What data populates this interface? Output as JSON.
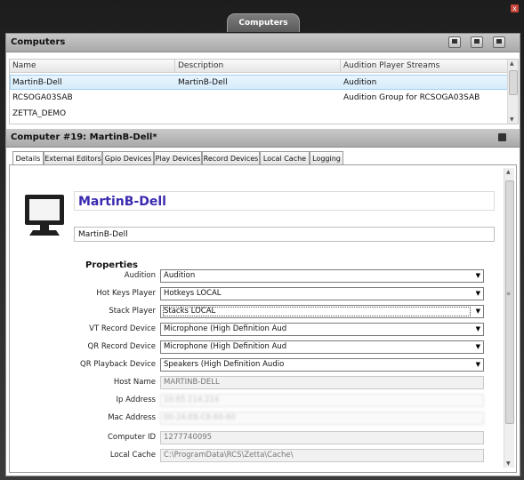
{
  "window": {
    "title": "Computers",
    "close_glyph": "x"
  },
  "computers_section": {
    "title": "Computers",
    "toolbar_icons": [
      "monitor-icon",
      "computer-add-icon",
      "computer-settings-icon"
    ],
    "columns": [
      "Name",
      "Description",
      "Audition Player Streams"
    ],
    "rows": [
      {
        "name": "MartinB-Dell",
        "description": "MartinB-Dell",
        "streams": "Audition"
      },
      {
        "name": "RCSOGA03SAB",
        "description": "",
        "streams": "Audition Group for RCSOGA03SAB"
      },
      {
        "name": "ZETTA_DEMO",
        "description": "",
        "streams": ""
      }
    ]
  },
  "detail_section": {
    "title": "Computer #19: MartinB-Dell*",
    "save_icon": "save-icon",
    "tabs": [
      "Details",
      "External Editors",
      "Gpio Devices",
      "Play Devices",
      "Record Devices",
      "Local Cache",
      "Logging"
    ],
    "active_tab": "Details",
    "computer_name": "MartinB-Dell",
    "computer_description": "MartinB-Dell",
    "properties_title": "Properties",
    "properties": {
      "audition": {
        "label": "Audition",
        "value": "Audition"
      },
      "hot_keys_player": {
        "label": "Hot Keys Player",
        "value": "Hotkeys LOCAL"
      },
      "stack_player": {
        "label": "Stack Player",
        "value": "Stacks LOCAL"
      },
      "vt_record_device": {
        "label": "VT Record Device",
        "value": "Microphone (High Definition Aud"
      },
      "qr_record_device": {
        "label": "QR Record Device",
        "value": "Microphone (High Definition Aud"
      },
      "qr_playback_device": {
        "label": "QR Playback Device",
        "value": "Speakers (High Definition Audio"
      },
      "host_name": {
        "label": "Host Name",
        "value": "MARTINB-DELL"
      },
      "ip_address": {
        "label": "Ip Address",
        "value": "10.65.114.214"
      },
      "mac_address": {
        "label": "Mac Address",
        "value": "00-24-E8-C8-60-60"
      },
      "computer_id": {
        "label": "Computer ID",
        "value": "1277740095"
      },
      "local_cache": {
        "label": "Local Cache",
        "value": "C:\\ProgramData\\RCS\\Zetta\\Cache\\"
      }
    }
  },
  "colors": {
    "title_accent": "#3a2ab0",
    "selection": "#d6ecfb"
  }
}
